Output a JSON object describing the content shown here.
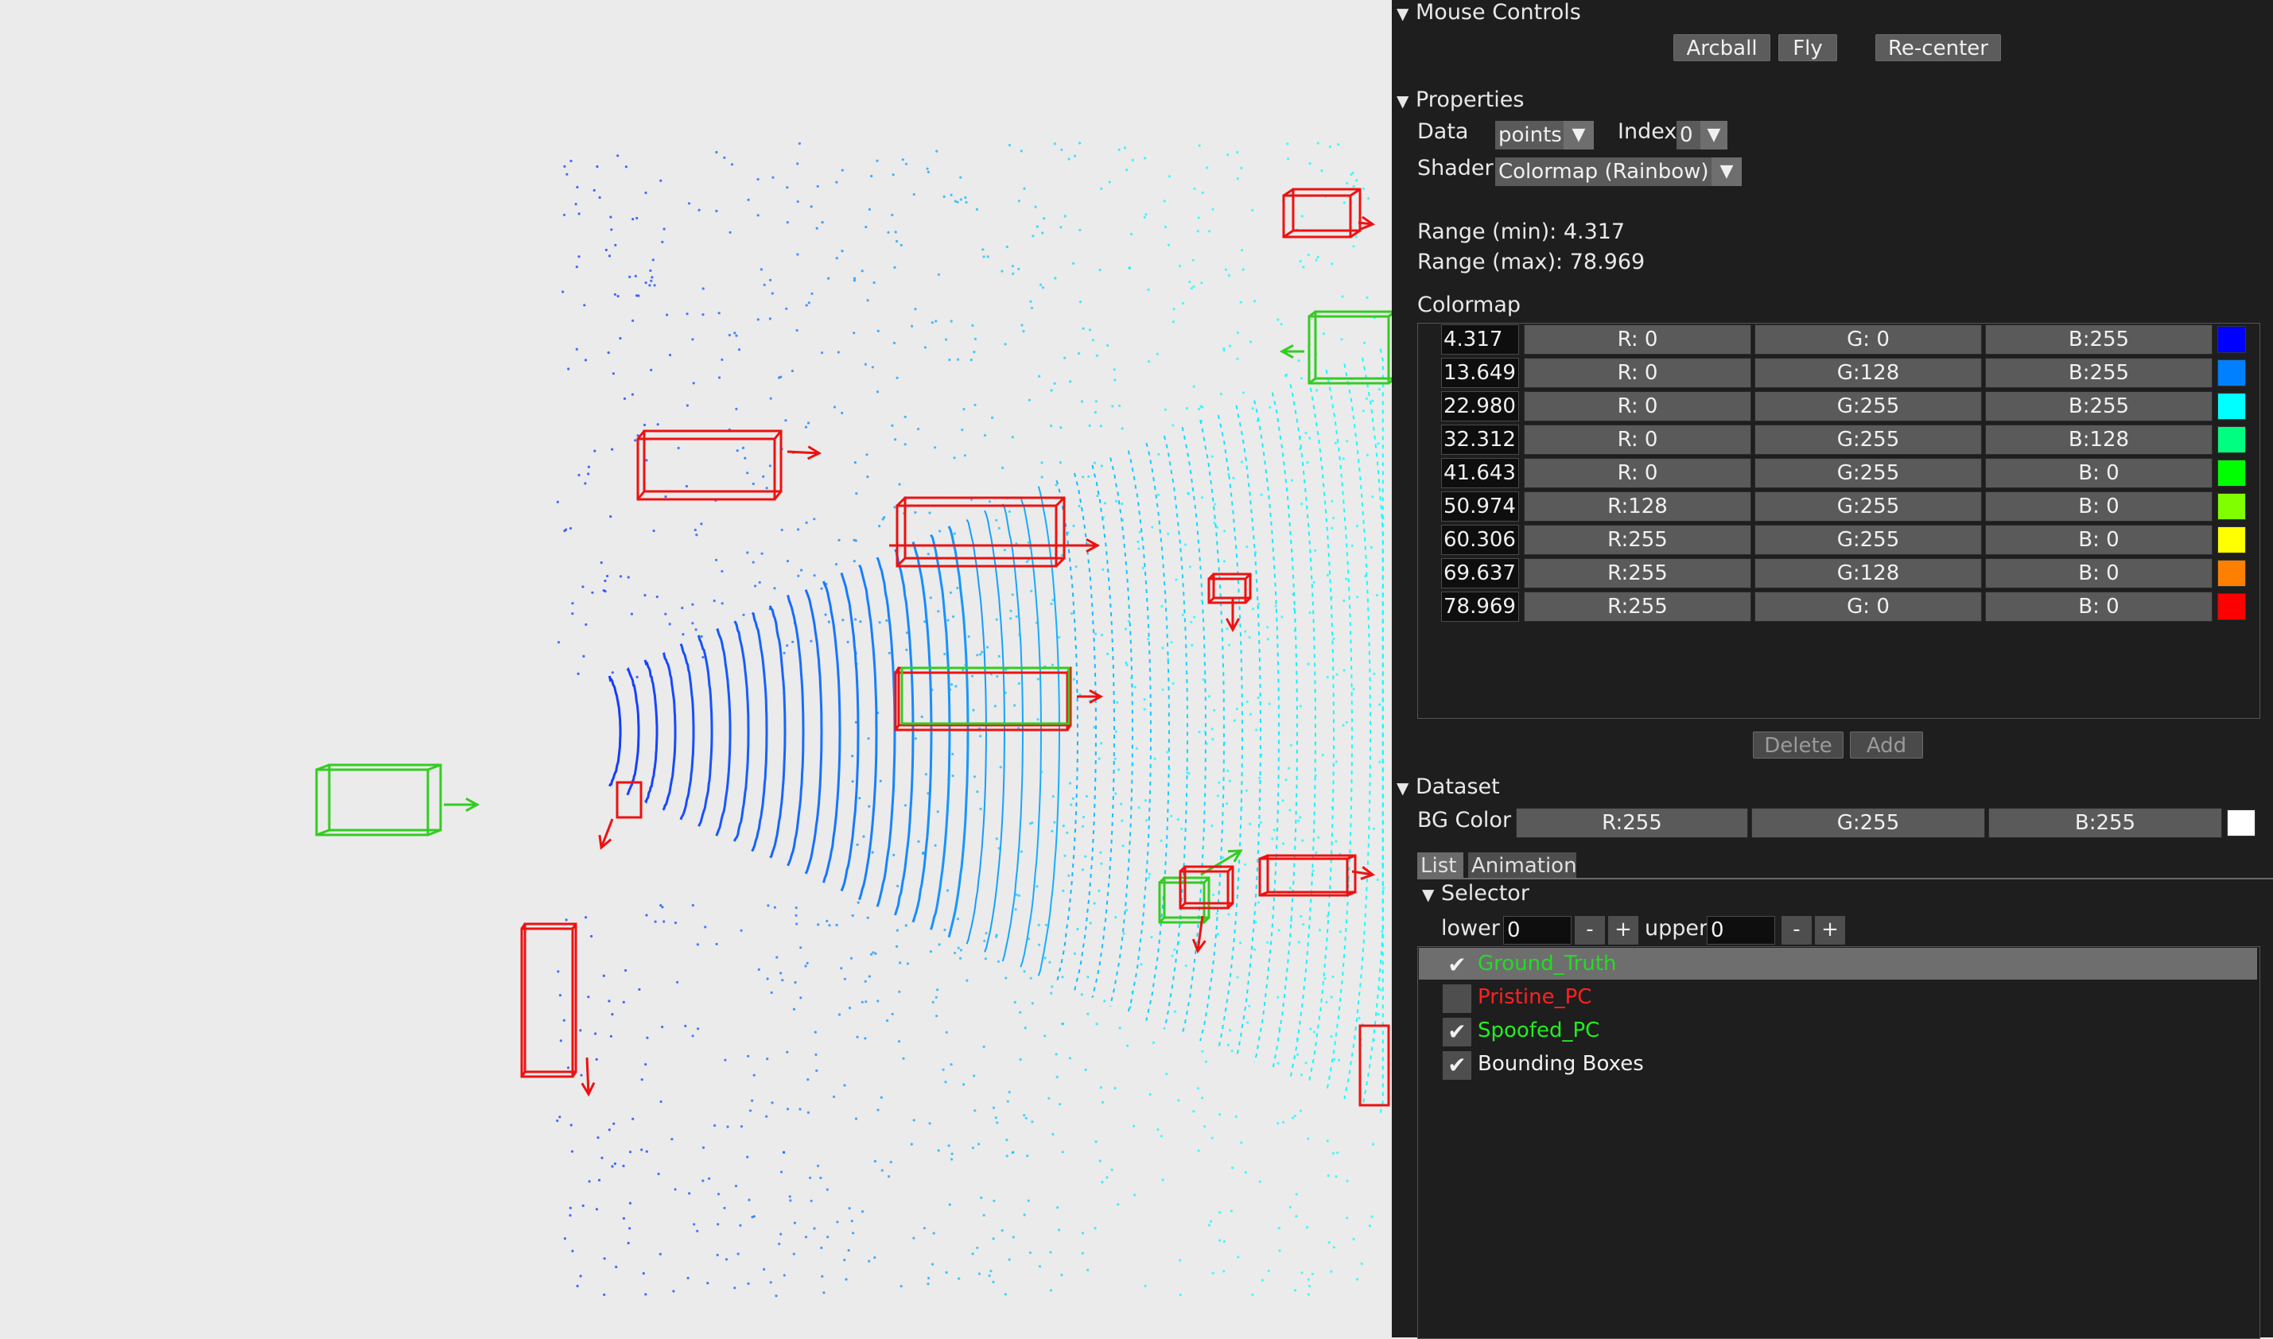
{
  "mouse_controls": {
    "header": "Mouse Controls",
    "buttons": [
      "Arcball",
      "Fly",
      "Re-center"
    ]
  },
  "properties": {
    "header": "Properties",
    "data_label": "Data",
    "data_value": "points",
    "index_label": "Index",
    "index_value": "0",
    "shader_label": "Shader",
    "shader_value": "Colormap (Rainbow)",
    "range_min": "Range (min):  4.317",
    "range_max": "Range (max): 78.969",
    "colormap_label": "Colormap",
    "colormap": [
      {
        "value": "4.317",
        "r": "R:  0",
        "g": "G:  0",
        "b": "B:255",
        "color": "#0000ff"
      },
      {
        "value": "13.649",
        "r": "R:  0",
        "g": "G:128",
        "b": "B:255",
        "color": "#0080ff"
      },
      {
        "value": "22.980",
        "r": "R:  0",
        "g": "G:255",
        "b": "B:255",
        "color": "#00ffff"
      },
      {
        "value": "32.312",
        "r": "R:  0",
        "g": "G:255",
        "b": "B:128",
        "color": "#00ff80"
      },
      {
        "value": "41.643",
        "r": "R:  0",
        "g": "G:255",
        "b": "B:  0",
        "color": "#00ff00"
      },
      {
        "value": "50.974",
        "r": "R:128",
        "g": "G:255",
        "b": "B:  0",
        "color": "#80ff00"
      },
      {
        "value": "60.306",
        "r": "R:255",
        "g": "G:255",
        "b": "B:  0",
        "color": "#ffff00"
      },
      {
        "value": "69.637",
        "r": "R:255",
        "g": "G:128",
        "b": "B:  0",
        "color": "#ff8000"
      },
      {
        "value": "78.969",
        "r": "R:255",
        "g": "G:  0",
        "b": "B:  0",
        "color": "#ff0000"
      }
    ],
    "delete_label": "Delete",
    "add_label": "Add"
  },
  "dataset": {
    "header": "Dataset",
    "bg_color_label": "BG Color",
    "bg_r": "R:255",
    "bg_g": "G:255",
    "bg_b": "B:255",
    "bg_swatch": "#ffffff",
    "tabs": [
      "List",
      "Animation"
    ],
    "selector_header": "Selector",
    "lower_label": "lower",
    "lower_value": "0",
    "upper_label": "upper",
    "upper_value": "0",
    "minus": "-",
    "plus": "+",
    "items": [
      {
        "label": "Ground_Truth",
        "checked": true,
        "color": "#22dd22",
        "selected": true
      },
      {
        "label": "Pristine_PC",
        "checked": false,
        "color": "#ff2222",
        "selected": false
      },
      {
        "label": "Spoofed_PC",
        "checked": true,
        "color": "#22ee22",
        "selected": false
      },
      {
        "label": "Bounding Boxes",
        "checked": true,
        "color": "#f0f0f0",
        "selected": false
      }
    ],
    "check_glyph": "✔"
  },
  "viewport": {
    "background": "#ebebeb",
    "box_colors": {
      "pristine": "#ee1111",
      "ground_truth": "#33cc22"
    }
  }
}
